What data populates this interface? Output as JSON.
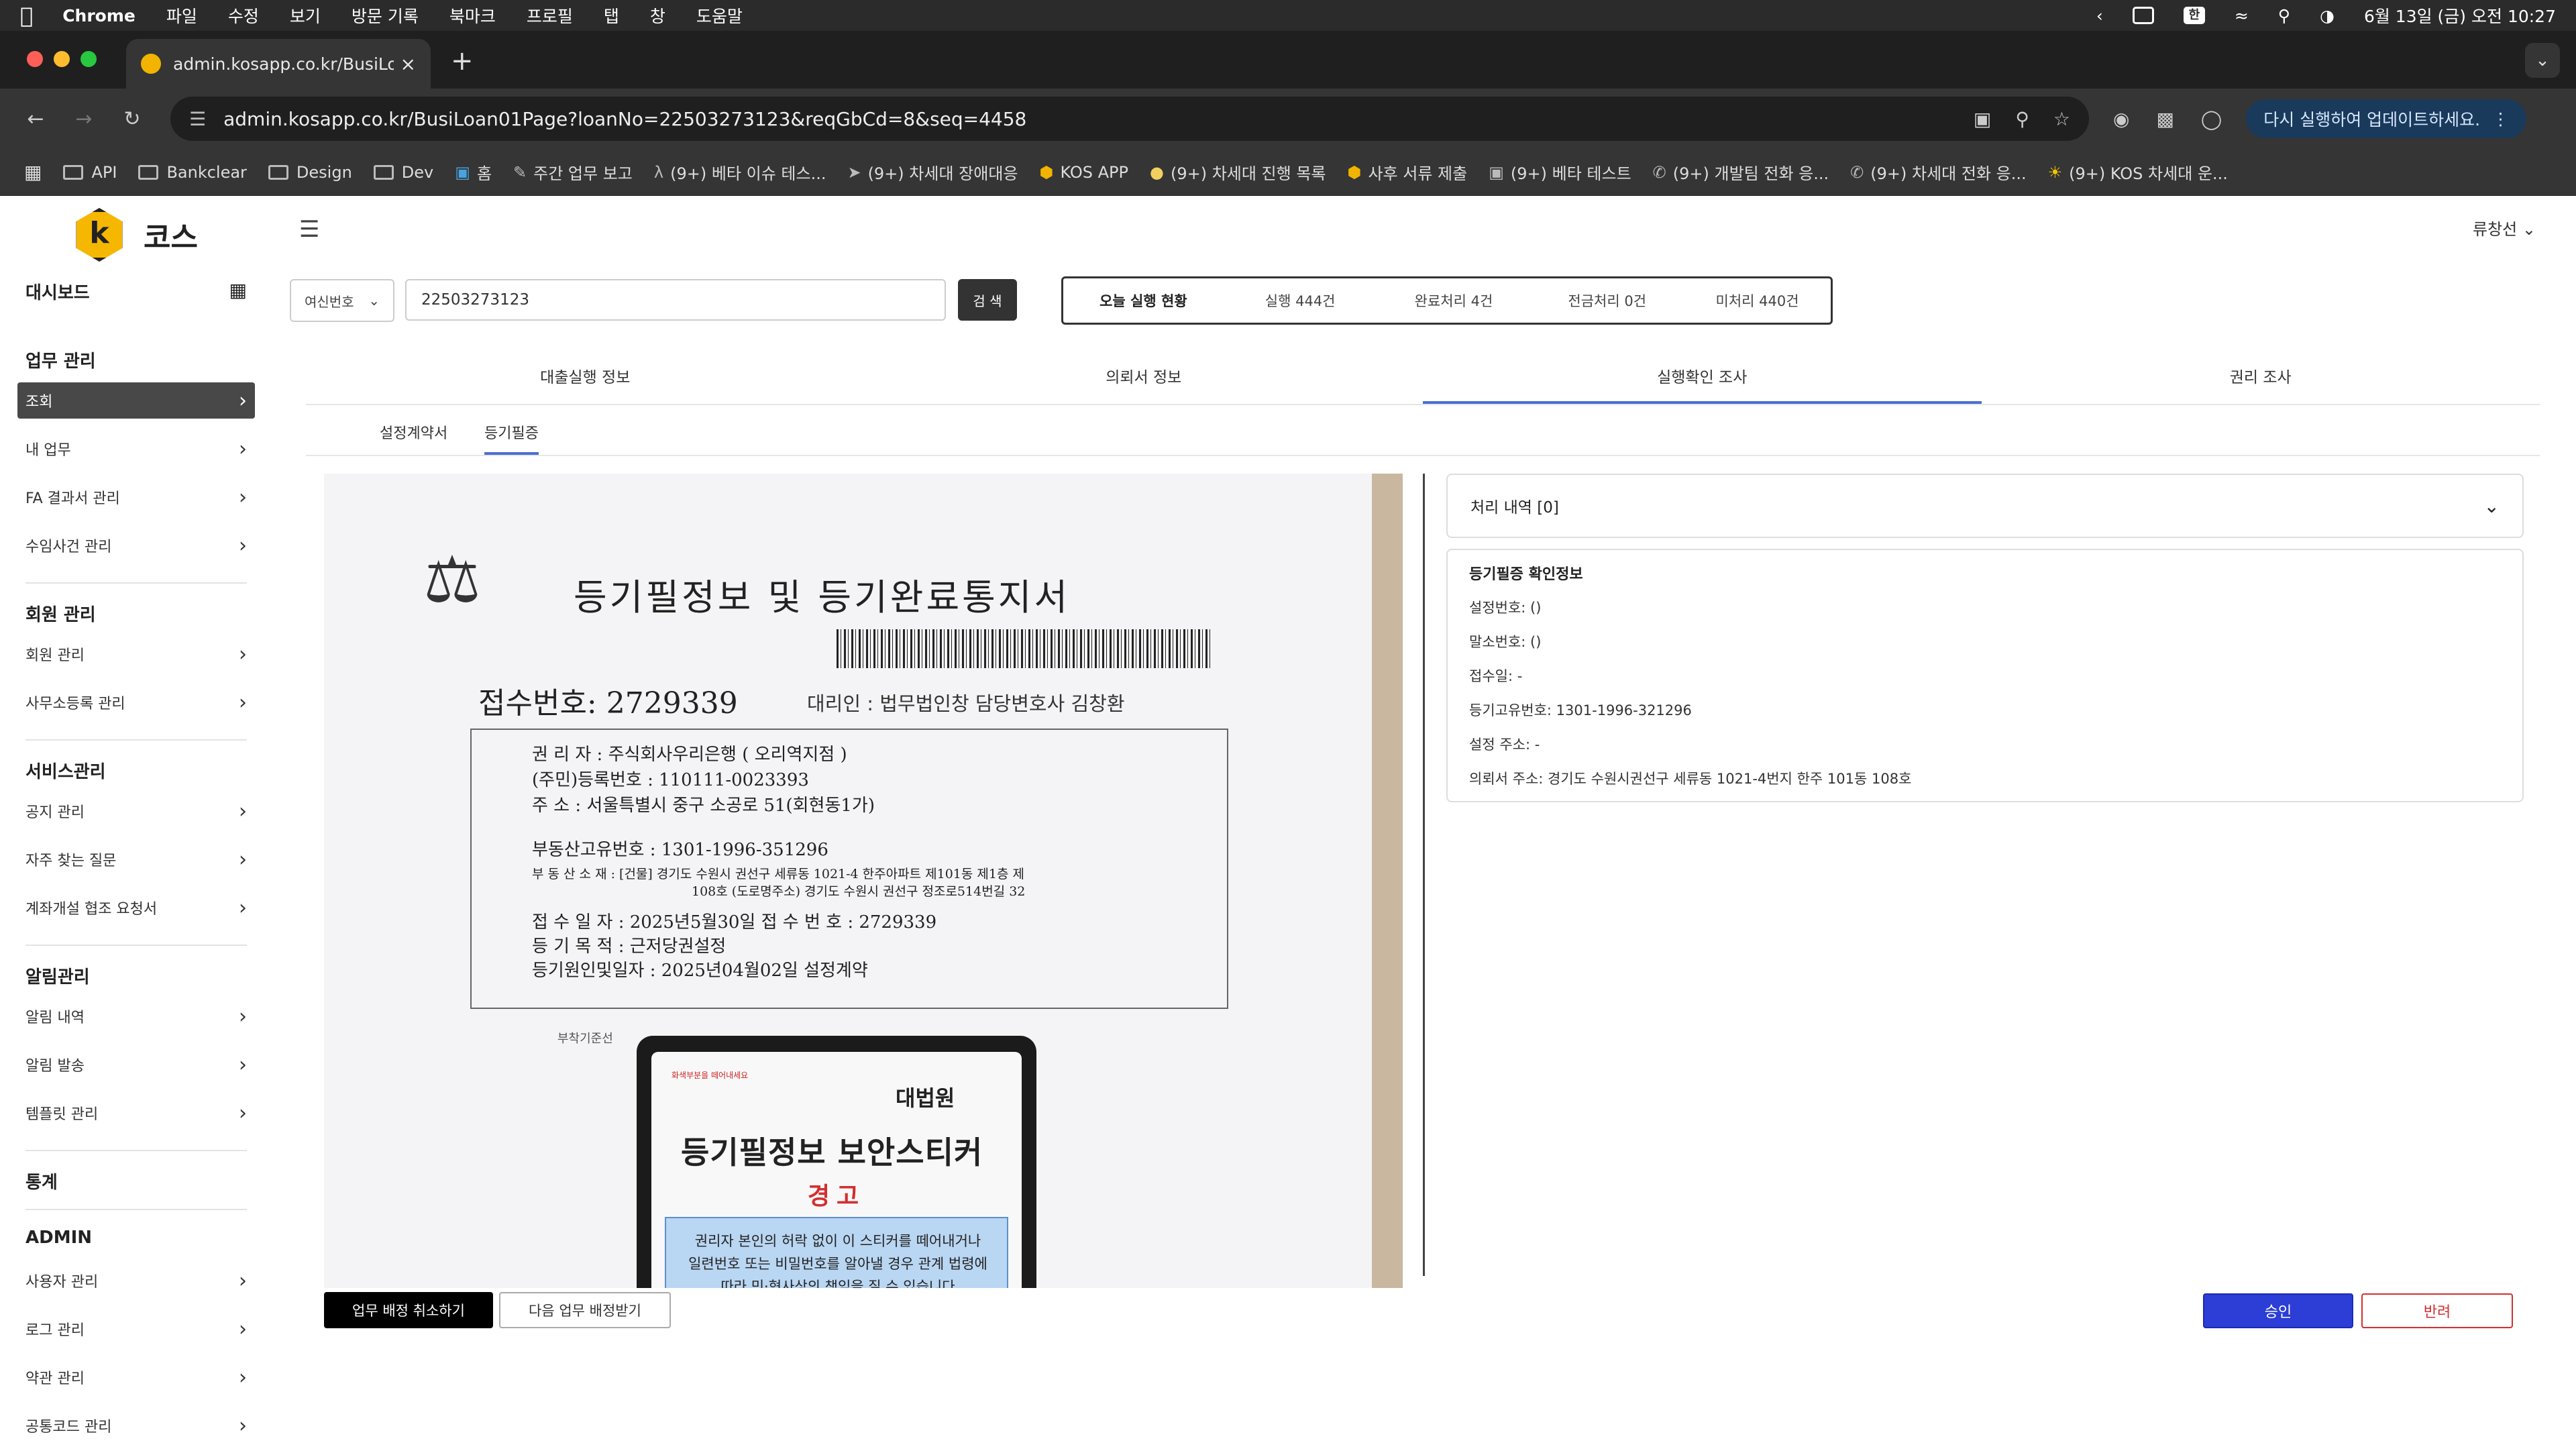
{
  "menubar": {
    "app": "Chrome",
    "items": [
      "파일",
      "수정",
      "보기",
      "방문 기록",
      "북마크",
      "프로필",
      "탭",
      "창",
      "도움말"
    ],
    "input_method": "한",
    "datetime": "6월 13일 (금) 오전 10:27"
  },
  "browser": {
    "tab_title": "admin.kosapp.co.kr/BusiLoan",
    "url": "admin.kosapp.co.kr/BusiLoan01Page?loanNo=22503273123&reqGbCd=8&seq=4458",
    "update_label": "다시 실행하여 업데이트하세요.",
    "bookmarks": [
      {
        "label": "API",
        "icon": "folder-icon"
      },
      {
        "label": "Bankclear",
        "icon": "folder-icon"
      },
      {
        "label": "Design",
        "icon": "folder-icon"
      },
      {
        "label": "Dev",
        "icon": "folder-icon"
      },
      {
        "label": "홈",
        "icon": "page-icon"
      },
      {
        "label": "주간 업무 보고",
        "icon": "note-icon"
      },
      {
        "label": "(9+) 베타 이슈 테스...",
        "icon": "figure-icon"
      },
      {
        "label": "(9+) 차세대 장애대응",
        "icon": "plane-icon"
      },
      {
        "label": "KOS APP",
        "icon": "kos-icon"
      },
      {
        "label": "(9+) 차세대 진행 목록",
        "icon": "bulb-icon"
      },
      {
        "label": "사후 서류 제출",
        "icon": "kos-icon"
      },
      {
        "label": "(9+) 베타 테스트",
        "icon": "notion-icon"
      },
      {
        "label": "(9+) 개발팀 전화 응...",
        "icon": "phone-icon"
      },
      {
        "label": "(9+) 차세대 전화 응...",
        "icon": "phone-icon"
      },
      {
        "label": "(9+) KOS 차세대 운...",
        "icon": "sun-icon"
      }
    ]
  },
  "sidebar": {
    "logo_text": "코스",
    "dashboard": "대시보드",
    "sections": [
      {
        "title": "업무 관리",
        "items": [
          "조회",
          "내 업무",
          "FA 결과서 관리",
          "수임사건 관리"
        ]
      },
      {
        "title": "회원 관리",
        "items": [
          "회원 관리",
          "사무소등록 관리"
        ]
      },
      {
        "title": "서비스관리",
        "items": [
          "공지 관리",
          "자주 찾는 질문",
          "계좌개설 협조 요청서"
        ]
      },
      {
        "title": "알림관리",
        "items": [
          "알림 내역",
          "알림 발송",
          "템플릿 관리"
        ]
      },
      {
        "title": "통계",
        "items": []
      },
      {
        "title": "ADMIN",
        "items": [
          "사용자 관리",
          "로그 관리",
          "약관 관리",
          "공통코드 관리"
        ]
      }
    ]
  },
  "header": {
    "user": "류창선"
  },
  "search": {
    "select_label": "여신번호",
    "value": "22503273123",
    "button": "검 색"
  },
  "status": {
    "title": "오늘 실행 현황",
    "executed": "실행 444건",
    "completed": "완료처리 4건",
    "transfer": "전금처리 0건",
    "pending": "미처리 440건"
  },
  "tabs": [
    "대출실행 정보",
    "의뢰서 정보",
    "실행확인 조사",
    "권리 조사"
  ],
  "subtabs": [
    "설정계약서",
    "등기필증"
  ],
  "document": {
    "title": "등기필정보 및 등기완료통지서",
    "receipt": "접수번호: 2729339",
    "agent": "대리인 : 법무법인창 담당변호사 김창환",
    "holder": "권    리    자 : 주식회사우리은행 ( 오리역지점 )",
    "reg_no": "(주민)등록번호 : 110111-0023393",
    "address": "주              소 : 서울특별시 중구 소공로 51(회현동1가)",
    "property_no": "부동산고유번호 : 1301-1996-351296",
    "location_1": "부 동 산 소 재 : [건물] 경기도 수원시 권선구 세류동 1021-4 한주아파트 제101동 제1층 제",
    "location_2": "108호 (도로명주소) 경기도 수원시 권선구 정조로514번길 32",
    "receipt_date": "접   수   일   자 : 2025년5월30일     접   수   번   호 : 2729339",
    "purpose": "등   기   목   적 : 근저당권설정",
    "cause": "등기원인및일자 : 2025년04월02일 설정계약",
    "caption": "부착기준선",
    "sticker_brand": "대법원",
    "sticker_warn": "화색부분을 떼어내세요",
    "sticker_title": "등기필정보 보안스티커",
    "sticker_alert": "경고",
    "sticker_text_1": "권리자 본인의 허락 없이 이 스티커를 떼어내거나",
    "sticker_text_2": "일련번호 또는 비밀번호를 알아낼 경우 관계 법령에",
    "sticker_text_3": "따라 민·형사상의 책임을 질 수 있습니다"
  },
  "actions": {
    "cancel_assign": "업무 배정 취소하기",
    "next_assign": "다음 업무 배정받기",
    "approve": "승인",
    "reject": "반려"
  },
  "panel": {
    "history": "처리 내역 [0]",
    "info_title": "등기필증 확인정보",
    "lines": [
      "설정번호: ()",
      "말소번호: ()",
      "접수일: -",
      "등기고유번호: 1301-1996-321296",
      "설정 주소: -",
      "의뢰서 주소: 경기도 수원시권선구 세류동  1021-4번지 한주 101동 108호"
    ]
  }
}
